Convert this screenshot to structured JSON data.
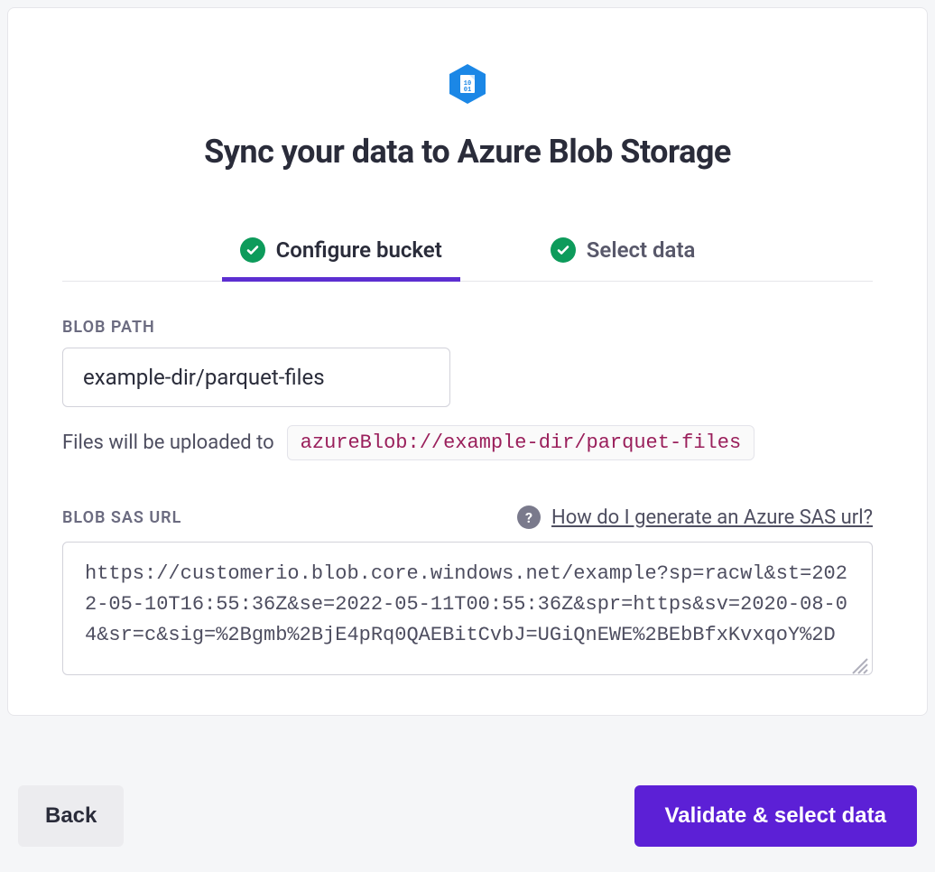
{
  "header": {
    "title": "Sync your data to Azure Blob Storage"
  },
  "tabs": {
    "configure": {
      "label": "Configure bucket",
      "complete": true,
      "active": true
    },
    "select": {
      "label": "Select data",
      "complete": true,
      "active": false
    }
  },
  "form": {
    "blob_path": {
      "label": "BLOB PATH",
      "value": "example-dir/parquet-files",
      "hint_prefix": "Files will be uploaded to",
      "hint_path": "azureBlob://example-dir/parquet-files"
    },
    "sas_url": {
      "label": "BLOB SAS URL",
      "help_link": "How do I generate an Azure SAS url?",
      "value": "https://customerio.blob.core.windows.net/example?sp=racwl&st=2022-05-10T16:55:36Z&se=2022-05-11T00:55:36Z&spr=https&sv=2020-08-04&sr=c&sig=%2Bgmb%2BjE4pRq0QAEBitCvbJ=UGiQnEWE%2BEbBfxKvxqoY%2D"
    }
  },
  "footer": {
    "back": "Back",
    "next": "Validate & select data"
  },
  "icons": {
    "brand": "azure-blob-icon"
  }
}
